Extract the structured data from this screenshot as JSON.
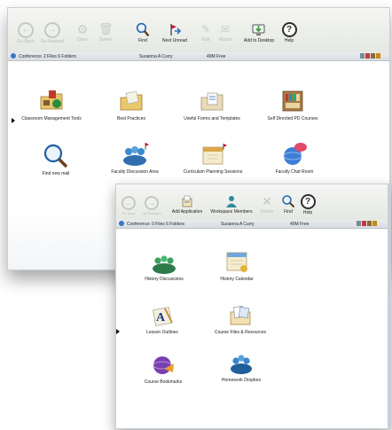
{
  "window1": {
    "toolbar": {
      "back": "Go Back",
      "forward": "Go Forward",
      "open": "Open",
      "delete": "Delete",
      "find": "Find",
      "next_unread": "Next Unread",
      "edit": "Edit",
      "attach": "Attach",
      "add_to_desktop": "Add to Desktop",
      "help": "Help"
    },
    "status": {
      "conference": "Conference",
      "counts": "2 Files 6 Folders",
      "user": "Susanna A Curry",
      "free": "49M Free"
    },
    "items": [
      {
        "label": "Classroom Management Tools"
      },
      {
        "label": "Best Practices"
      },
      {
        "label": "Useful Forms and Templates"
      },
      {
        "label": "Self Directed PD Courses"
      },
      {
        "label": "Find new mail"
      },
      {
        "label": "Faculty Discussion Area"
      },
      {
        "label": "Curriculum Planning Sessions"
      },
      {
        "label": "Faculty Chat Room"
      }
    ]
  },
  "window2": {
    "toolbar": {
      "back": "Go Back",
      "forward": "Go Forward",
      "add_application": "Add Application",
      "workspace_members": "Workspace Members",
      "delete": "Delete",
      "find": "Find",
      "help": "Help"
    },
    "status": {
      "conference": "Conference",
      "counts": "0 Files 6 Folders",
      "user": "Susanna A Curry",
      "free": "49M Free"
    },
    "items": [
      {
        "label": "History Discussions"
      },
      {
        "label": "History Calendar"
      },
      {
        "label": "Lesson Outlines"
      },
      {
        "label": "Course Files & Resources"
      },
      {
        "label": "Course Bookmarks"
      },
      {
        "label": "Homework Dropbox"
      }
    ]
  },
  "colors": {
    "help_ring": "#2f2f2f",
    "find_glass": "#1e66b0",
    "next_unread_flag": "#c8102e",
    "desktop_green": "#3a9a3a"
  }
}
